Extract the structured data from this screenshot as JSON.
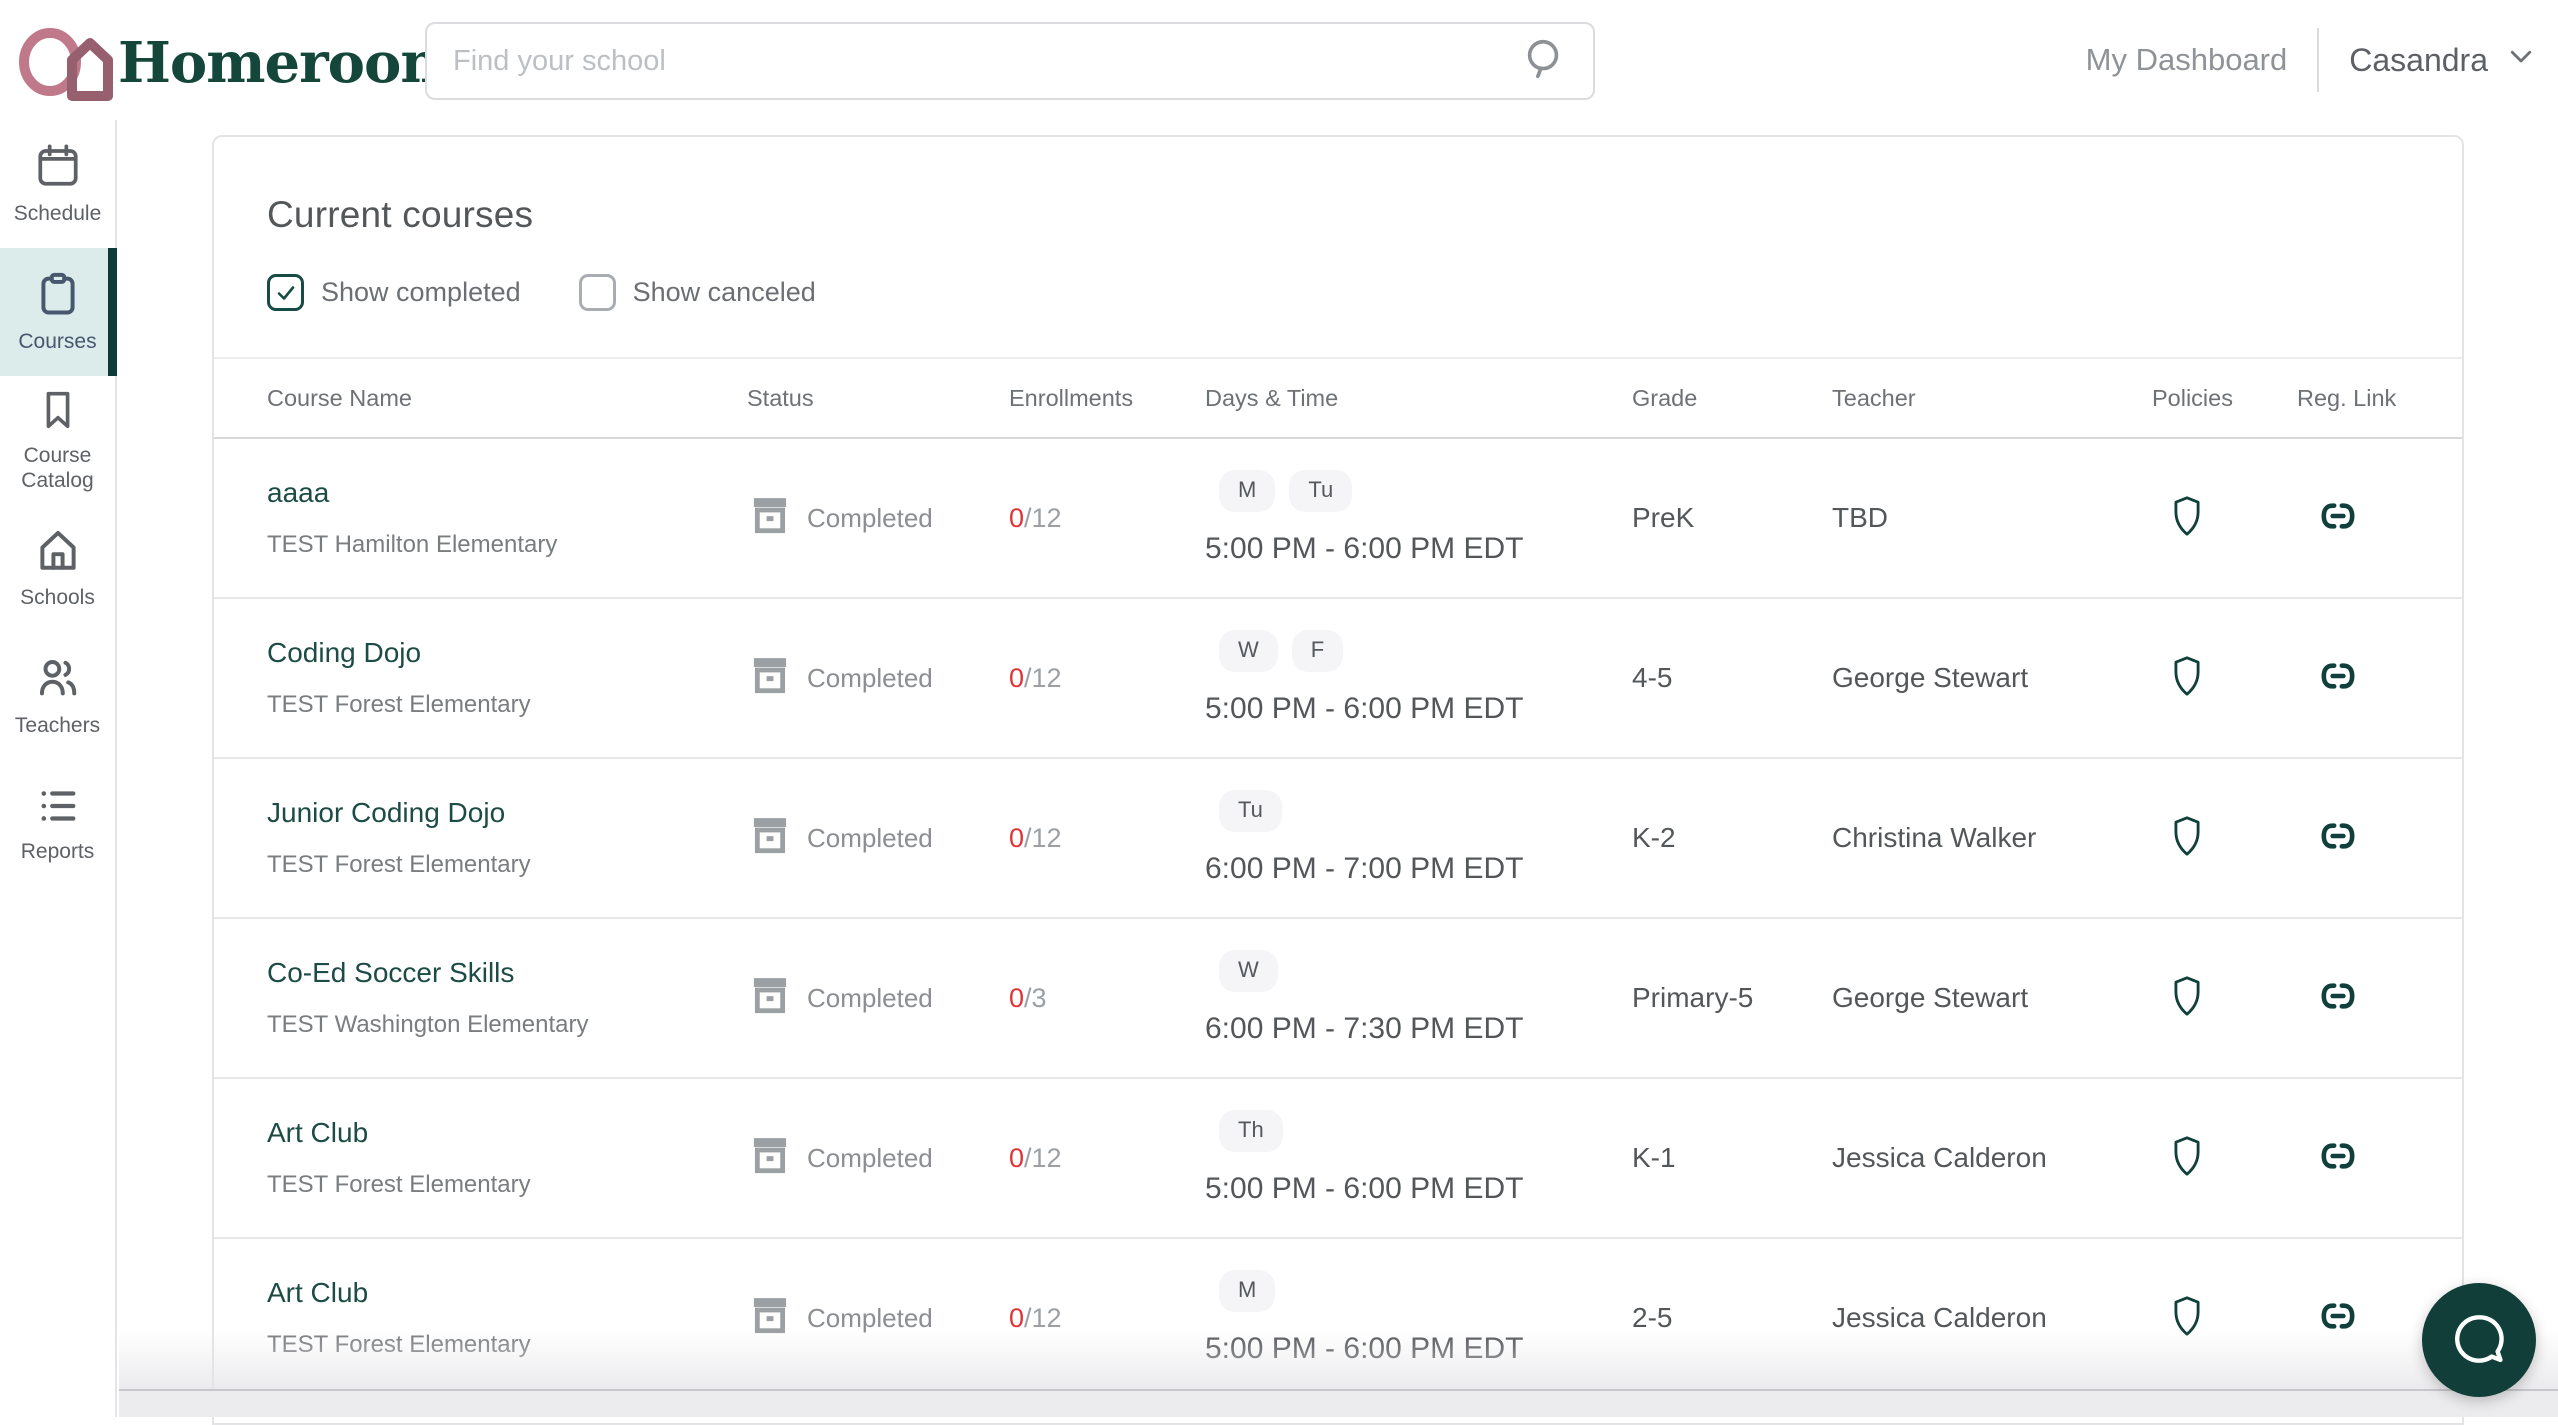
{
  "header": {
    "logo_text": "Homeroom",
    "search": {
      "placeholder": "Find your school"
    },
    "nav": {
      "dashboard_label": "My Dashboard",
      "user_name": "Casandra"
    }
  },
  "sidebar": {
    "items": [
      {
        "label": "Schedule",
        "icon": "calendar-icon",
        "active": false
      },
      {
        "label": "Courses",
        "icon": "clipboard-icon",
        "active": true
      },
      {
        "label": "Course Catalog",
        "icon": "bookmark-icon",
        "active": false
      },
      {
        "label": "Schools",
        "icon": "home-icon",
        "active": false
      },
      {
        "label": "Teachers",
        "icon": "users-icon",
        "active": false
      },
      {
        "label": "Reports",
        "icon": "list-icon",
        "active": false
      }
    ]
  },
  "main": {
    "title": "Current courses",
    "filters": [
      {
        "label": "Show completed",
        "checked": true
      },
      {
        "label": "Show canceled",
        "checked": false
      }
    ],
    "table": {
      "columns": [
        "Course Name",
        "Status",
        "Enrollments",
        "Days & Time",
        "Grade",
        "Teacher",
        "Policies",
        "Reg. Link"
      ],
      "rows": [
        {
          "course": "aaaa",
          "school": "TEST Hamilton Elementary",
          "status": "Completed",
          "enrolled": "0",
          "capacity": "/12",
          "days": [
            "M",
            "Tu"
          ],
          "time": "5:00 PM - 6:00 PM EDT",
          "grade": "PreK",
          "teacher": "TBD"
        },
        {
          "course": "Coding Dojo",
          "school": "TEST Forest Elementary",
          "status": "Completed",
          "enrolled": "0",
          "capacity": "/12",
          "days": [
            "W",
            "F"
          ],
          "time": "5:00 PM - 6:00 PM EDT",
          "grade": "4-5",
          "teacher": "George Stewart"
        },
        {
          "course": "Junior Coding Dojo",
          "school": "TEST Forest Elementary",
          "status": "Completed",
          "enrolled": "0",
          "capacity": "/12",
          "days": [
            "Tu"
          ],
          "time": "6:00 PM - 7:00 PM EDT",
          "grade": "K-2",
          "teacher": "Christina Walker"
        },
        {
          "course": "Co-Ed Soccer Skills",
          "school": "TEST Washington Elementary",
          "status": "Completed",
          "enrolled": "0",
          "capacity": "/3",
          "days": [
            "W"
          ],
          "time": "6:00 PM - 7:30 PM EDT",
          "grade": "Primary-5",
          "teacher": "George Stewart"
        },
        {
          "course": "Art Club",
          "school": "TEST Forest Elementary",
          "status": "Completed",
          "enrolled": "0",
          "capacity": "/12",
          "days": [
            "Th"
          ],
          "time": "5:00 PM - 6:00 PM EDT",
          "grade": "K-1",
          "teacher": "Jessica Calderon"
        },
        {
          "course": "Art Club",
          "school": "TEST Forest Elementary",
          "status": "Completed",
          "enrolled": "0",
          "capacity": "/12",
          "days": [
            "M"
          ],
          "time": "5:00 PM - 6:00 PM EDT",
          "grade": "2-5",
          "teacher": "Jessica Calderon"
        }
      ]
    }
  },
  "colors": {
    "accent_teal": "#123e3a",
    "link_green": "#1d4b45",
    "active_sidebar_bg": "#dcecea",
    "logo_rose": "#c0798a",
    "logo_maroon": "#96606f",
    "logo_green": "#14463a",
    "danger_red": "#e23339"
  }
}
